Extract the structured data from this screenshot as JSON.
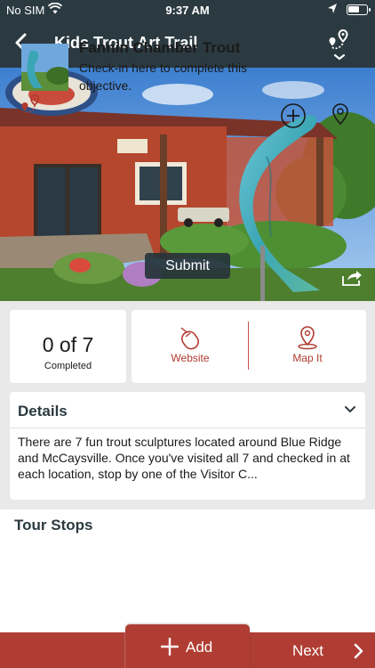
{
  "status_bar": {
    "carrier": "No SIM",
    "time": "9:37 AM"
  },
  "nav": {
    "title": "Kids Trout Art Trail"
  },
  "hero": {
    "submit_label": "Submit"
  },
  "progress": {
    "count": "0 of 7",
    "label": "Completed"
  },
  "actions": {
    "website_label": "Website",
    "map_label": "Map It"
  },
  "details": {
    "heading": "Details",
    "text": "There are 7 fun trout sculptures located around Blue Ridge and McCaysville. Once you've visited all 7 and checked in at each location, stop by one of the Visitor C..."
  },
  "tour_stops": {
    "heading": "Tour Stops",
    "items": [
      {
        "name": "Fannin Chamber Trout",
        "description": "Check-in here to complete this objective."
      }
    ]
  },
  "bottom_bar": {
    "add_label": "Add",
    "next_label": "Next"
  },
  "colors": {
    "header": "#2b3a40",
    "accent": "#b03d34"
  }
}
